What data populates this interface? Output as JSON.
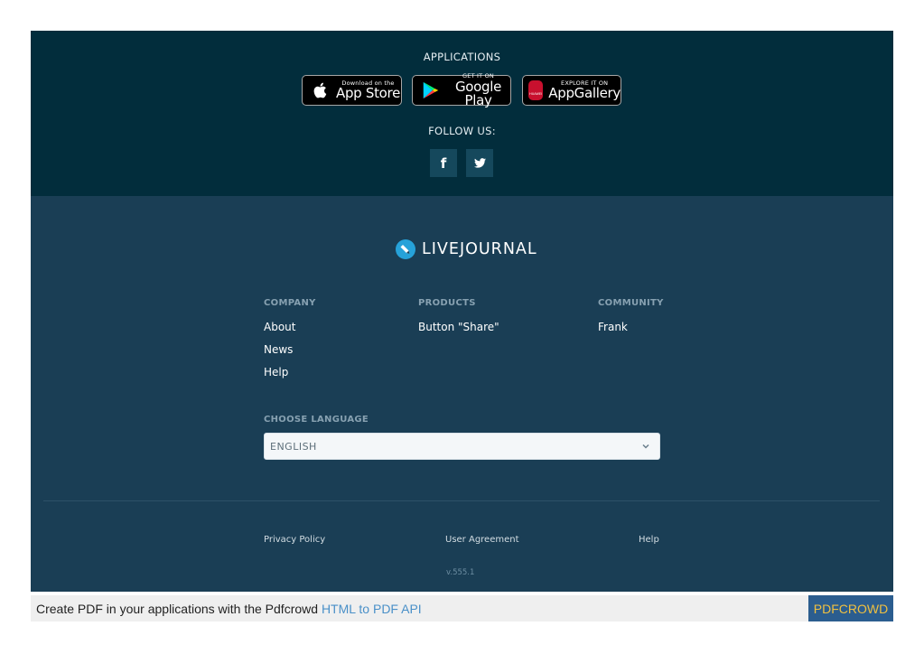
{
  "applications": {
    "heading": "APPLICATIONS",
    "badges": [
      {
        "small": "Download on the",
        "big": "App Store",
        "icon": "apple-icon"
      },
      {
        "small": "GET IT ON",
        "big": "Google Play",
        "icon": "google-play-icon"
      },
      {
        "small": "EXPLORE IT ON",
        "big": "AppGallery",
        "icon": "huawei-icon",
        "icon_text": "HUAWEI"
      }
    ]
  },
  "follow": {
    "heading": "FOLLOW US:",
    "buttons": [
      {
        "glyph": "f",
        "icon": "facebook-icon"
      },
      {
        "glyph": "🐦",
        "icon": "twitter-icon"
      }
    ]
  },
  "logo": {
    "text": "LIVEJOURNAL",
    "icon": "livejournal-logo-icon"
  },
  "columns": [
    {
      "heading": "COMPANY",
      "links": [
        "About",
        "News",
        "Help"
      ]
    },
    {
      "heading": "PRODUCTS",
      "links": [
        "Button \"Share\""
      ]
    },
    {
      "heading": "COMMUNITY",
      "links": [
        "Frank"
      ]
    }
  ],
  "language": {
    "heading": "CHOOSE LANGUAGE",
    "selected": "ENGLISH"
  },
  "bottom_links": [
    "Privacy Policy",
    "User Agreement",
    "Help"
  ],
  "version": "v.555.1",
  "pdf_banner": {
    "prefix": "Create PDF in your applications with the Pdfcrowd",
    "link": "HTML to PDF API",
    "brand": "PDFCROWD"
  },
  "colors": {
    "apps_bg": "#022d3c",
    "footer_bg": "#1a3e55",
    "logo_accent": "#26a2d9",
    "brand_bg": "#2b5d8f",
    "brand_text": "#f0c040"
  }
}
